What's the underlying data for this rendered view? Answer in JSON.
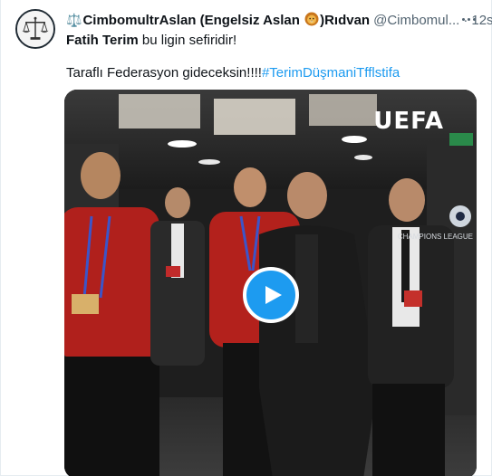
{
  "tweet": {
    "emoji_prefix": "⚖️",
    "display_name_part1": "CimbomultrAslan (Engelsiz Aslan ",
    "lion_icon": "lion-face-icon",
    "display_name_part2": ")Rıdvan",
    "handle": "@Cimbomul...",
    "separator": "·",
    "time": "12s",
    "line1_bold": "Fatih Terim",
    "line1_rest": " bu ligin sefiridir!",
    "line2_text": "Taraflı Federasyon gideceksin!!!!",
    "line2_hashtag": "#TerimDüşmaniTfflstifa"
  },
  "media": {
    "watermark": "UEFA",
    "champions_text": "CHAMPIONS LEAGUE",
    "play_icon": "play-icon",
    "accent": "#1d9bf0"
  },
  "colors": {
    "text": "#0f1419",
    "secondary": "#536471",
    "link": "#1d9bf0"
  }
}
